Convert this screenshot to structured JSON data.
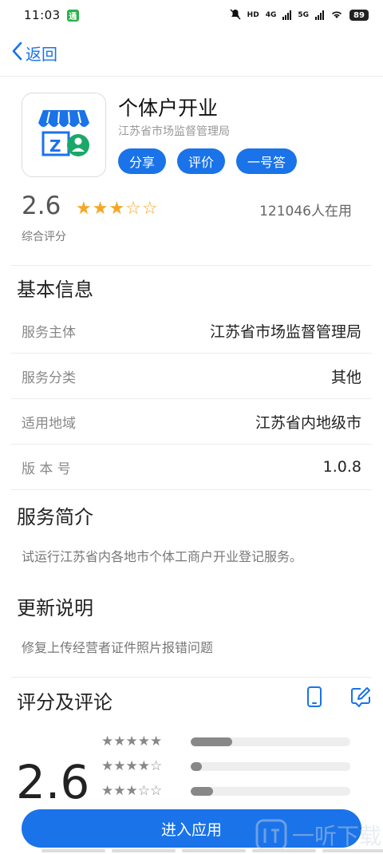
{
  "status_bar": {
    "time": "11:03",
    "app_badge": "通",
    "network_hd": "HD",
    "network_4g": "4G",
    "network_5g": "5G",
    "battery": "89"
  },
  "nav": {
    "back_label": "返回"
  },
  "app": {
    "name": "个体户开业",
    "developer": "江苏省市场监督管理局",
    "chips": [
      "分享",
      "评价",
      "一号答"
    ]
  },
  "rating": {
    "score": "2.6",
    "stars_on": "★★★",
    "stars_off": "☆☆",
    "users": "121046人在用",
    "caption": "综合评分"
  },
  "basic_info": {
    "title": "基本信息",
    "rows": [
      {
        "key": "服务主体",
        "value": "江苏省市场监督管理局"
      },
      {
        "key": "服务分类",
        "value": "其他"
      },
      {
        "key": "适用地域",
        "value": "江苏省内地级市"
      },
      {
        "key": "版 本 号",
        "value": "1.0.8"
      }
    ]
  },
  "intro": {
    "title": "服务简介",
    "text": "试运行江苏省内各地市个体工商户开业登记服务。"
  },
  "update": {
    "title": "更新说明",
    "text": "修复上传经营者证件照片报错问题"
  },
  "reviews": {
    "title": "评分及评论",
    "score": "2.6",
    "distribution": [
      {
        "stars": "★★★★★",
        "fraction": 0.26
      },
      {
        "stars": "★★★★☆",
        "fraction": 0.07
      },
      {
        "stars": "★★★☆☆",
        "fraction": 0.14
      }
    ]
  },
  "enter_button": "进入应用",
  "watermark": "一听下载"
}
